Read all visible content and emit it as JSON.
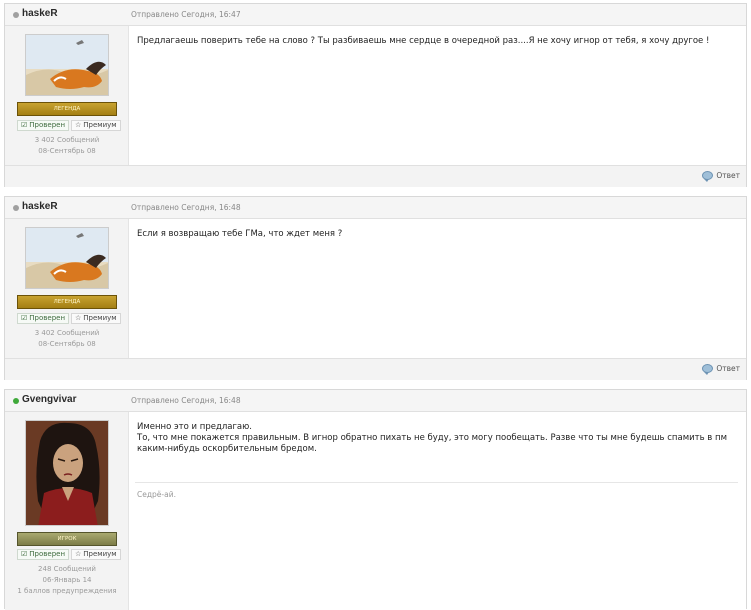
{
  "posts": [
    {
      "author": "haskeR",
      "online": false,
      "date": "Отправлено Сегодня, 16:47",
      "rank": "ЛЕГЕНДА",
      "verified": "Проверен",
      "premium": "Премиум",
      "posts_count": "3 402 Сообщений",
      "joined": "08-Сентябрь 08",
      "text": "Предлагаешь поверить тебе на слово ? Ты разбиваешь мне сердце в очередной раз....Я не хочу игнор от тебя, я хочу другое !",
      "reply": "Ответ"
    },
    {
      "author": "haskeR",
      "online": false,
      "date": "Отправлено Сегодня, 16:48",
      "rank": "ЛЕГЕНДА",
      "verified": "Проверен",
      "premium": "Премиум",
      "posts_count": "3 402 Сообщений",
      "joined": "08-Сентябрь 08",
      "text": "Если я возвращаю тебе ГМа, что ждет меня ?",
      "reply": "Ответ"
    },
    {
      "author": "Gvengvivar",
      "online": true,
      "date": "Отправлено Сегодня, 16:48",
      "rank": "ИГРОК",
      "verified": "Проверен",
      "premium": "Премиум",
      "posts_count": "248 Сообщений",
      "joined": "06-Январь 14",
      "warnings": "1 баллов предупреждения",
      "text_line1": "Именно это и предлагаю.",
      "text_line2": "То, что мне покажется правильным. В игнор обратно пихать не буду, это могу пообещать. Разве что ты мне будешь спамить в пм каким-нибудь оскорбительным бредом.",
      "signature": "Седрё-ай."
    }
  ],
  "colors": {
    "online": "#3fa93a",
    "offline": "#a0a0a0",
    "rank_gold": "#b8921f"
  },
  "icons": {
    "verified": "check-icon",
    "premium": "star-icon",
    "reply": "speech-bubble-icon"
  }
}
